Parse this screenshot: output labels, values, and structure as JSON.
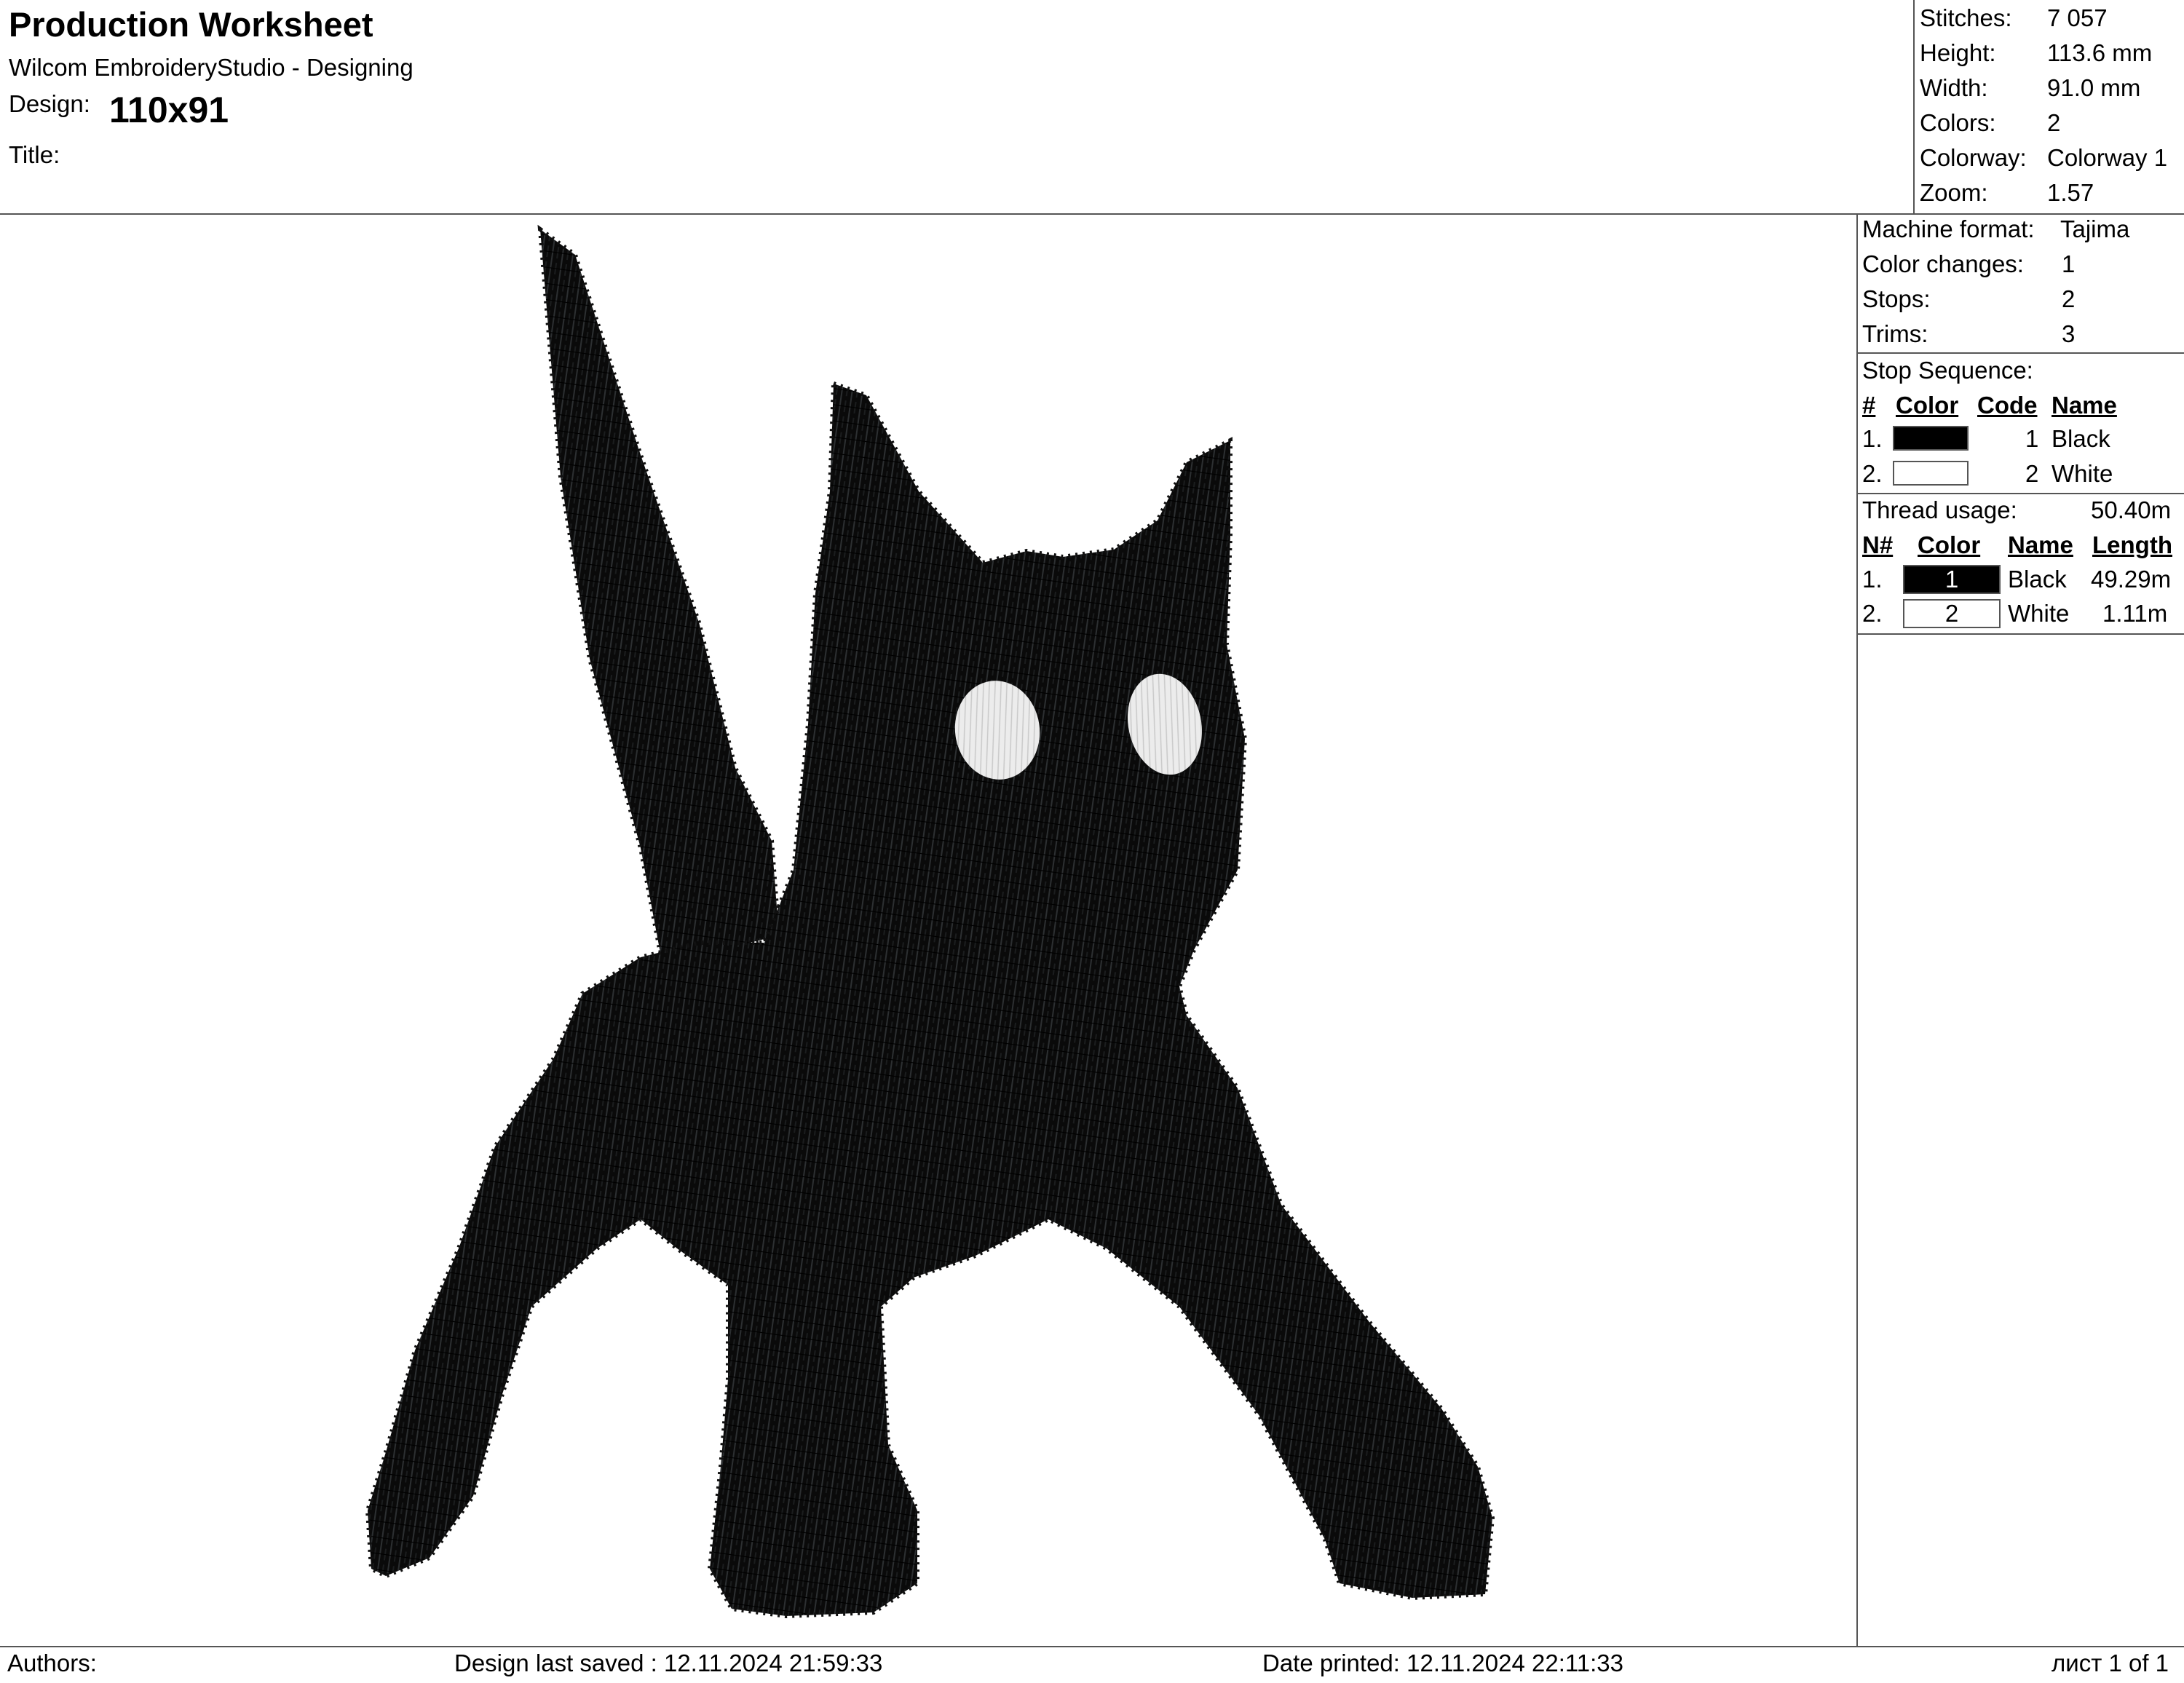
{
  "header": {
    "title": "Production Worksheet",
    "app": "Wilcom EmbroideryStudio - Designing",
    "design_label": "Design:",
    "design_value": "110x91",
    "title_label": "Title:"
  },
  "stats": [
    {
      "label": "Stitches:",
      "value": "7 057"
    },
    {
      "label": "Height:",
      "value": "113.6 mm"
    },
    {
      "label": "Width:",
      "value": "91.0 mm"
    },
    {
      "label": "Colors:",
      "value": "2"
    },
    {
      "label": "Colorway:",
      "value": "Colorway 1"
    },
    {
      "label": "Zoom:",
      "value": "1.57"
    }
  ],
  "machine": [
    {
      "label": "Machine format:",
      "value": "Tajima"
    },
    {
      "label": "Color changes:",
      "value": "1"
    },
    {
      "label": "Stops:",
      "value": "2"
    },
    {
      "label": "Trims:",
      "value": "3"
    }
  ],
  "stop_sequence": {
    "title": "Stop Sequence:",
    "headers": [
      "#",
      "Color",
      "Code",
      "Name"
    ],
    "rows": [
      {
        "index": "1.",
        "color": "#000000",
        "code": "1",
        "name": "Black"
      },
      {
        "index": "2.",
        "color": "#ffffff",
        "code": "2",
        "name": "White"
      }
    ]
  },
  "thread_usage": {
    "label": "Thread usage:",
    "total": "50.40m",
    "headers": [
      "N#",
      "Color",
      "Name",
      "Length"
    ],
    "rows": [
      {
        "index": "1.",
        "code": "1",
        "color": "#000000",
        "text_color": "#ffffff",
        "name": "Black",
        "length": "49.29m"
      },
      {
        "index": "2.",
        "code": "2",
        "color": "#ffffff",
        "text_color": "#000000",
        "name": "White",
        "length": "1.11m"
      }
    ]
  },
  "footer": {
    "authors": "Authors:",
    "saved": "Design last saved : 12.11.2024 21:59:33",
    "printed": "Date printed: 12.11.2024 22:11:33",
    "page": "лист 1 of 1"
  }
}
